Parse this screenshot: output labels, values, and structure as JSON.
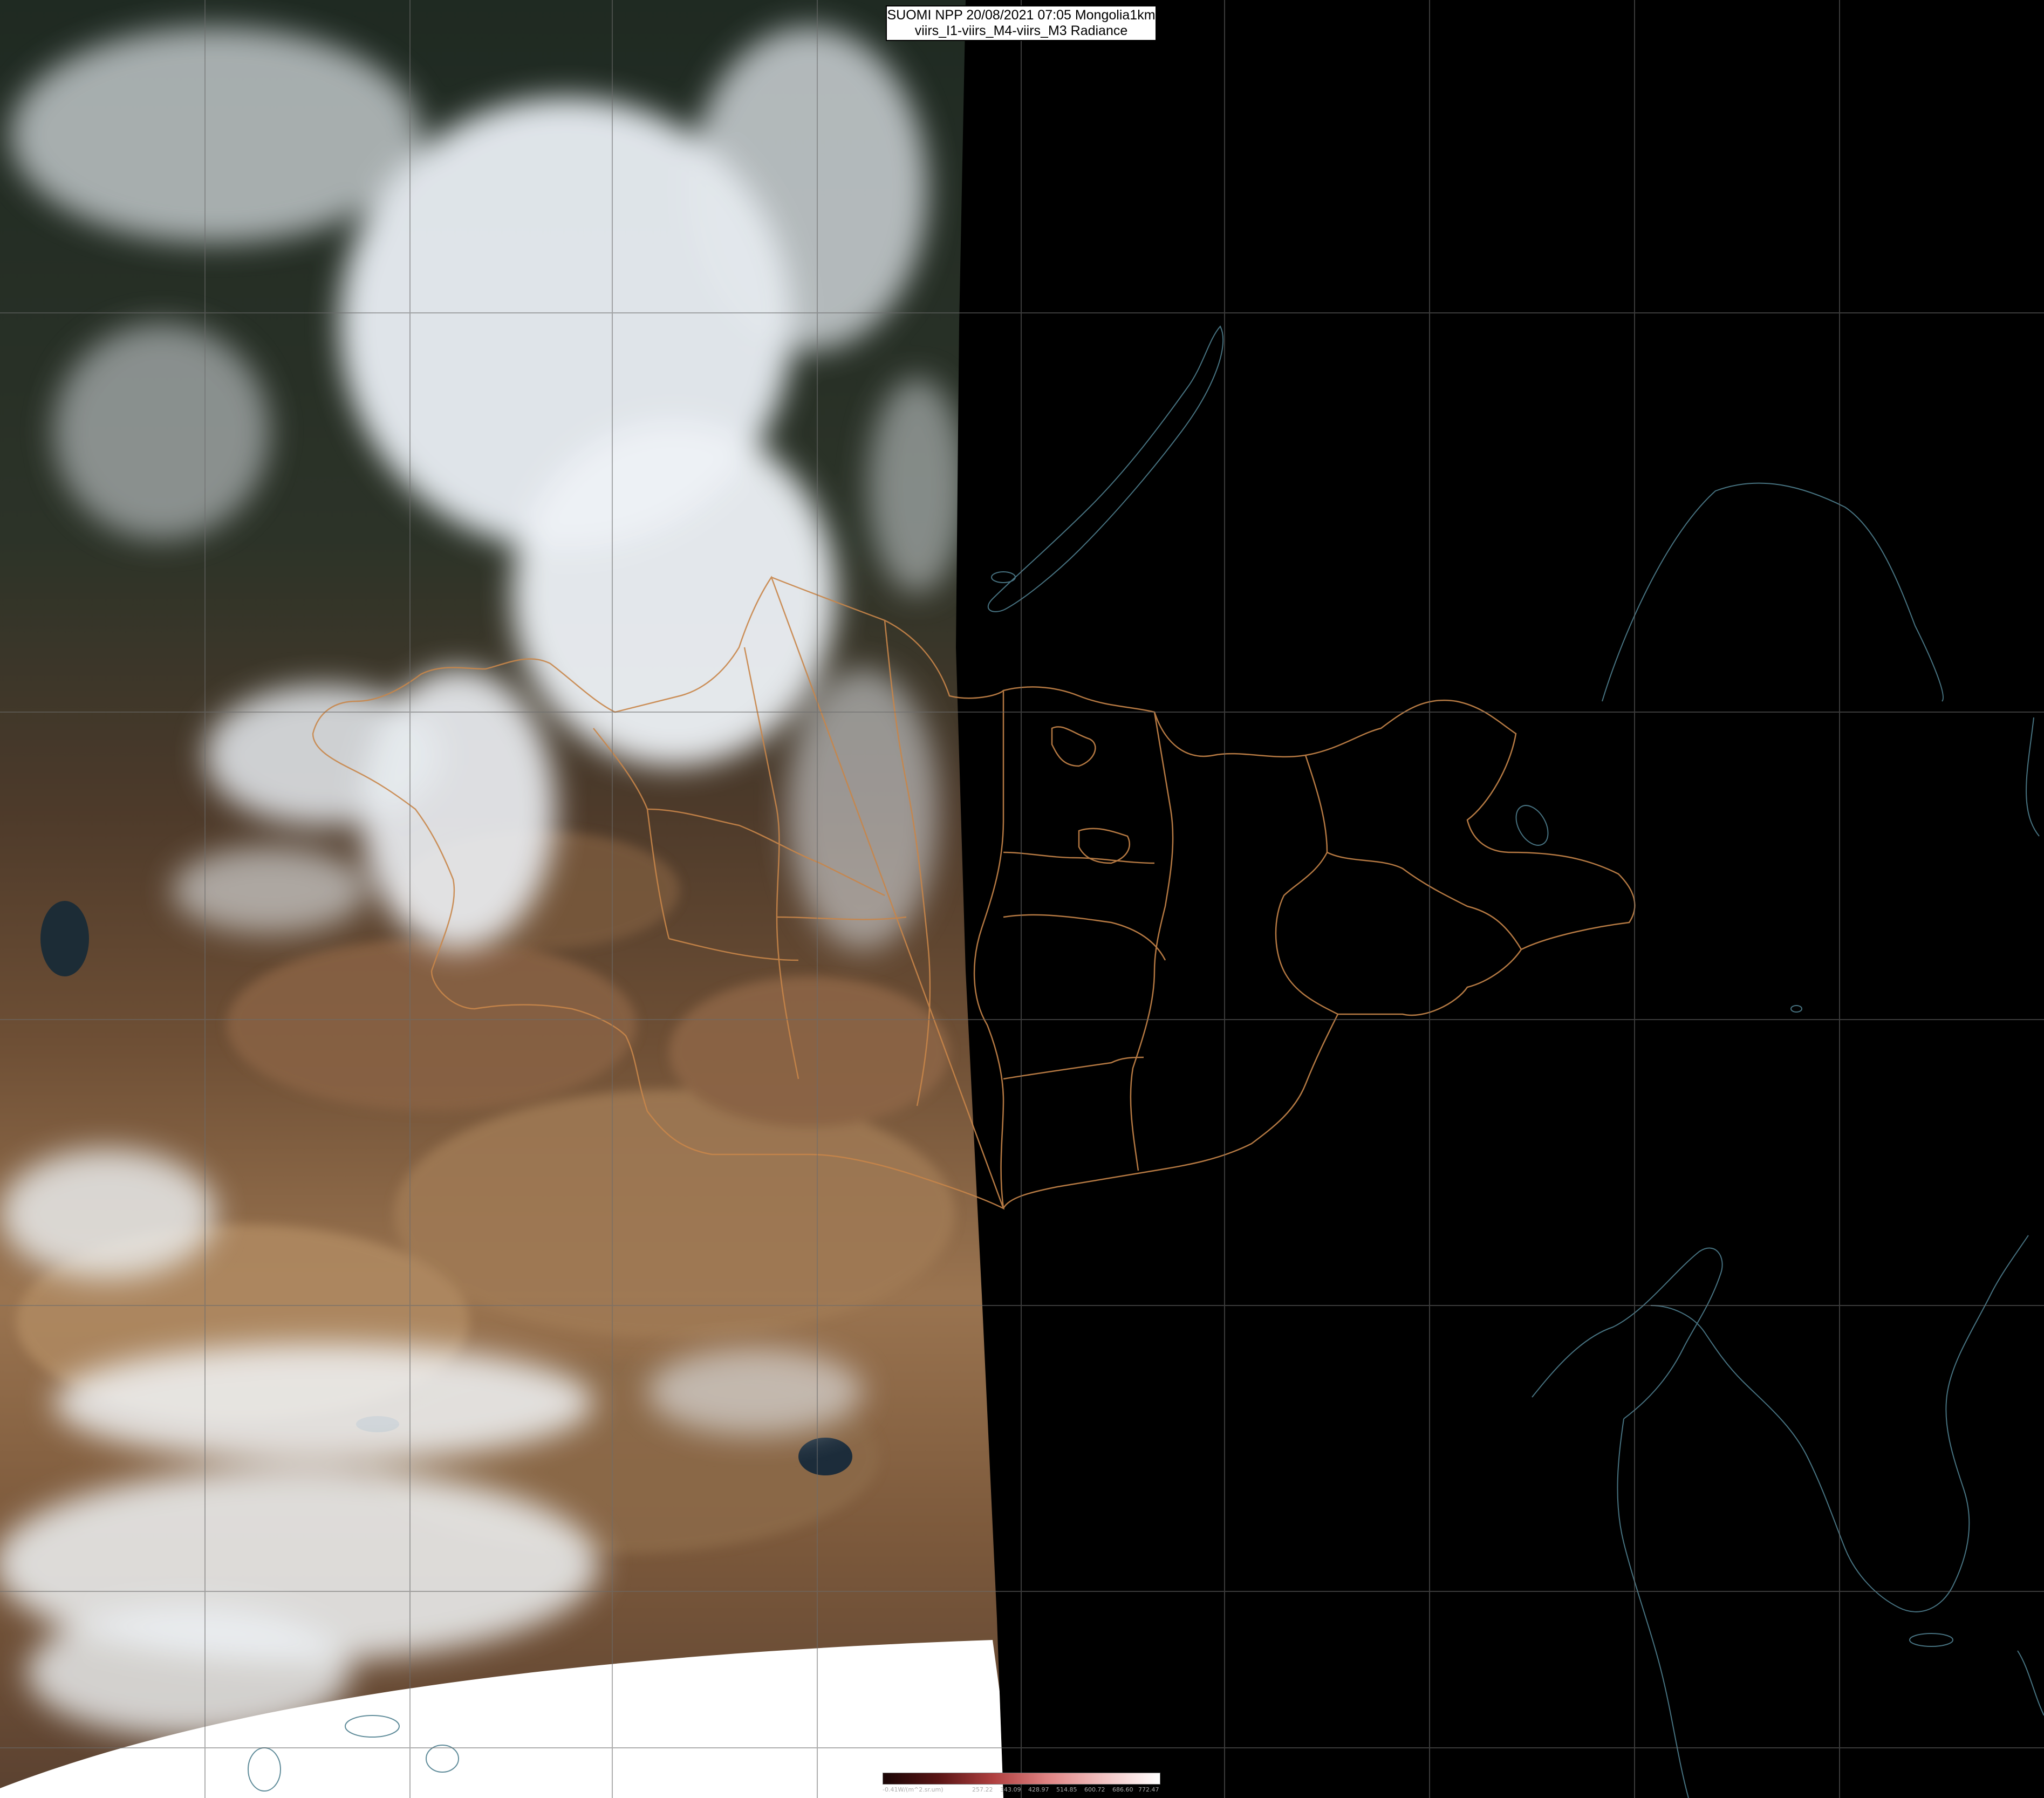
{
  "title": {
    "line1": "SUOMI NPP 20/08/2021 07:05 Mongolia1km",
    "line2": "viirs_I1-viirs_M4-viirs_M3 Radiance"
  },
  "colorbar": {
    "unit_label": "-0.41W/(m^2.sr.um)",
    "ticks": [
      "257.22",
      "343.09",
      "428.97",
      "514.85",
      "600.72",
      "686.60",
      "772.47"
    ],
    "colors": [
      "#1a0505",
      "#5a1515",
      "#b04040",
      "#e08585",
      "#f2c4c4",
      "#ffffff"
    ]
  },
  "colors": {
    "night_side": "#000000",
    "grid": "#6c6c6c",
    "coastline": "#4f7f8f",
    "admin_border": "#c8864a",
    "desert": "#9a7450",
    "cloud": "#f2f5f8",
    "no_data": "#ffffff"
  }
}
